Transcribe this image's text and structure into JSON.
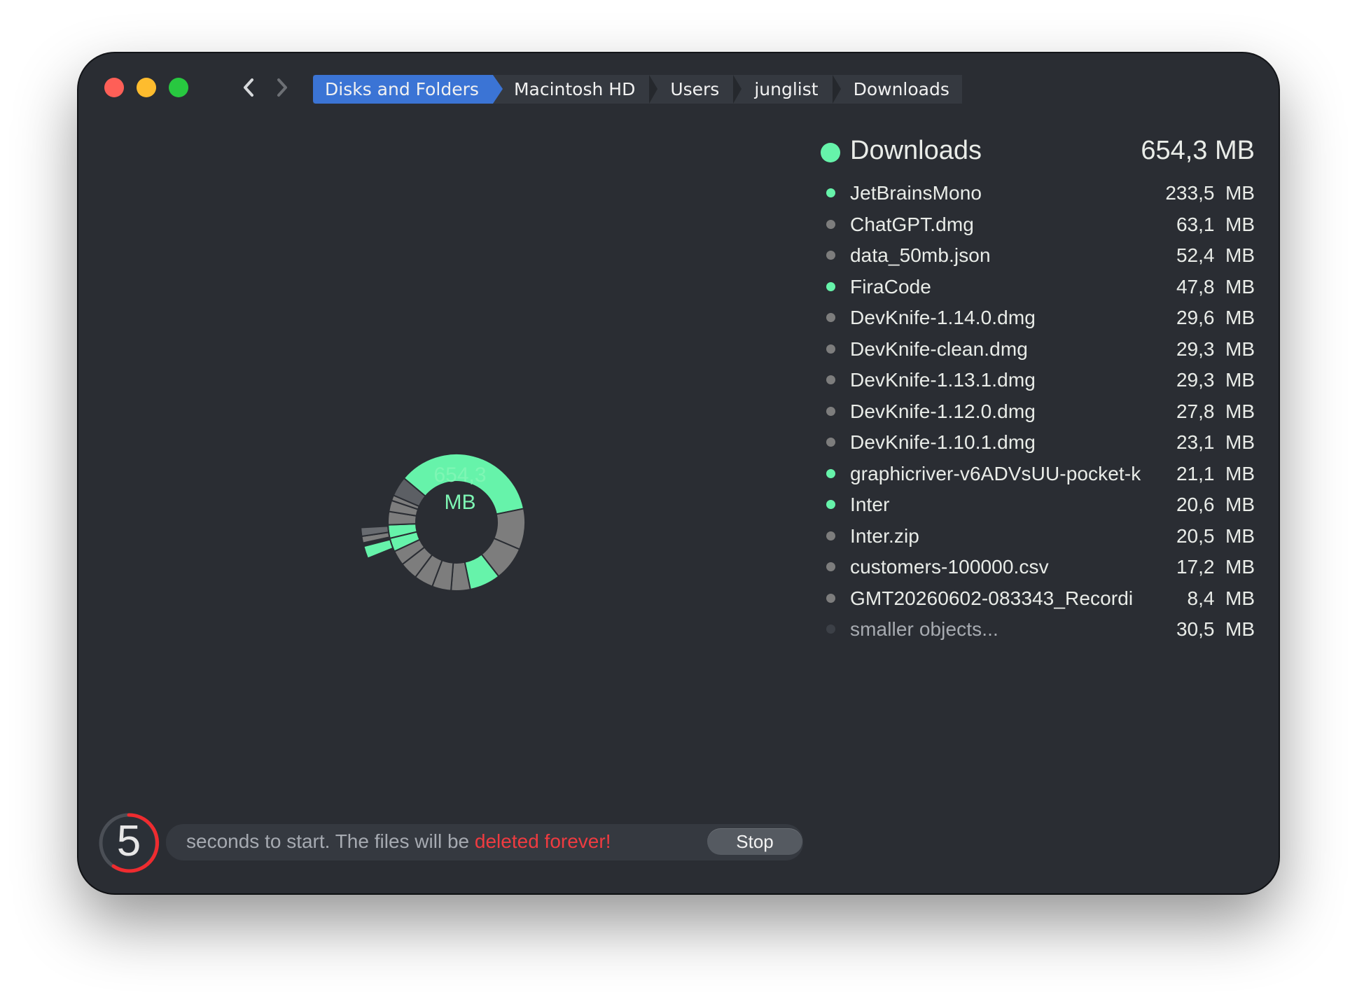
{
  "colors": {
    "accent": "#3b74d5",
    "folder": "#66f3aa",
    "file": "#7d7d7d",
    "smaller": "#3c4047",
    "danger": "#ef3b40",
    "background": "#2a2d33"
  },
  "breadcrumb": [
    "Disks and Folders",
    "Macintosh HD",
    "Users",
    "junglist",
    "Downloads"
  ],
  "summary": {
    "name": "Downloads",
    "size": "654,3 MB"
  },
  "center": {
    "value": "654,3",
    "unit": "MB"
  },
  "files": [
    {
      "name": "JetBrainsMono",
      "size": "233,5  MB",
      "kind": "folder"
    },
    {
      "name": "ChatGPT.dmg",
      "size": "63,1  MB",
      "kind": "file"
    },
    {
      "name": "data_50mb.json",
      "size": "52,4  MB",
      "kind": "file"
    },
    {
      "name": "FiraCode",
      "size": "47,8  MB",
      "kind": "folder"
    },
    {
      "name": "DevKnife-1.14.0.dmg",
      "size": "29,6  MB",
      "kind": "file"
    },
    {
      "name": "DevKnife-clean.dmg",
      "size": "29,3  MB",
      "kind": "file"
    },
    {
      "name": "DevKnife-1.13.1.dmg",
      "size": "29,3  MB",
      "kind": "file"
    },
    {
      "name": "DevKnife-1.12.0.dmg",
      "size": "27,8  MB",
      "kind": "file"
    },
    {
      "name": "DevKnife-1.10.1.dmg",
      "size": "23,1  MB",
      "kind": "file"
    },
    {
      "name": "graphicriver-v6ADVsUU-pocket-k",
      "size": "21,1  MB",
      "kind": "folder"
    },
    {
      "name": "Inter",
      "size": "20,6  MB",
      "kind": "folder"
    },
    {
      "name": "Inter.zip",
      "size": "20,5  MB",
      "kind": "file"
    },
    {
      "name": "customers-100000.csv",
      "size": "17,2  MB",
      "kind": "file"
    },
    {
      "name": "GMT20260602-083343_Recordi",
      "size": "8,4  MB",
      "kind": "file"
    },
    {
      "name": "smaller objects...",
      "size": "30,5  MB",
      "kind": "smaller"
    }
  ],
  "donut_values": [
    233.5,
    63.1,
    52.4,
    47.8,
    29.6,
    29.3,
    29.3,
    27.8,
    23.1,
    21.1,
    20.6,
    20.5,
    17.2,
    8.4,
    30.5
  ],
  "countdown": {
    "seconds": "5",
    "message": "seconds to start. The files will be ",
    "danger": "deleted forever!"
  },
  "button": {
    "stop": "Stop"
  }
}
